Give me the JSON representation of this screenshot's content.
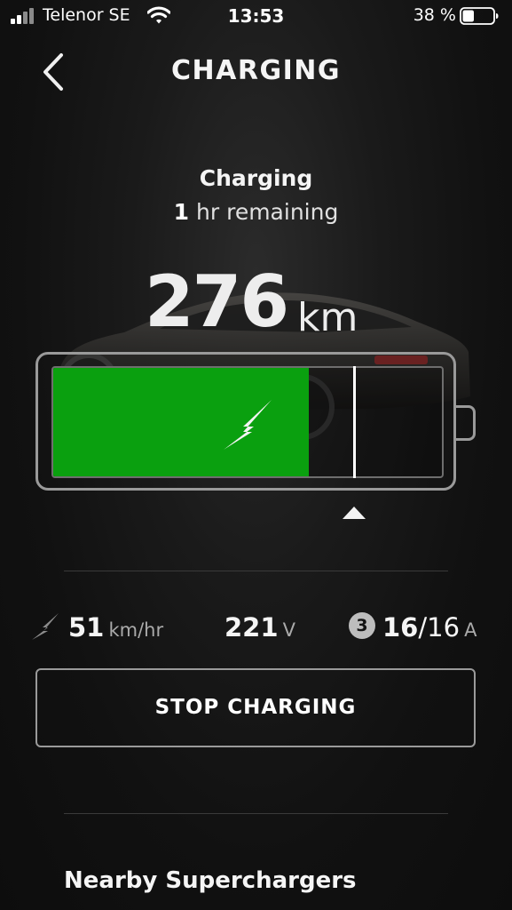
{
  "status_bar": {
    "carrier": "Telenor SE",
    "time": "13:53",
    "battery_percent": "38 %",
    "battery_level": 0.38
  },
  "header": {
    "back_icon": "chevron-left-icon",
    "title": "CHARGING"
  },
  "charge_status": {
    "state": "Charging",
    "remaining_number": "1",
    "remaining_text": " hr remaining"
  },
  "range": {
    "value": "276",
    "unit": "km"
  },
  "battery": {
    "fill_fraction": 0.658,
    "charge_limit_fraction": 0.775,
    "fill_color": "#0aa00f",
    "charging_icon": "lightning-bolt-icon"
  },
  "stats": {
    "speed": {
      "icon": "charge-rate-icon",
      "value": "51",
      "unit": "km/hr"
    },
    "voltage": {
      "value": "221",
      "unit": "V"
    },
    "current": {
      "phase": "3",
      "value": "16",
      "max": "/16",
      "unit": "A"
    }
  },
  "actions": {
    "stop_label": "STOP CHARGING"
  },
  "sections": {
    "nearby_title": "Nearby Superchargers"
  }
}
